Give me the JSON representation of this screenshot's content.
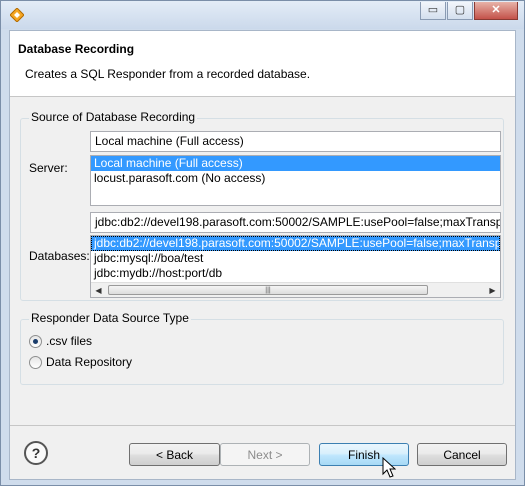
{
  "window": {
    "controls": {
      "minimize": "▭",
      "maximize": "▢",
      "close": "✕"
    }
  },
  "header": {
    "title": "Database Recording",
    "description": "Creates a SQL Responder from a recorded database."
  },
  "source_group": {
    "label": "Source of Database Recording",
    "server": {
      "label": "Server:",
      "value": "Local machine (Full access)",
      "options": [
        "Local machine (Full access)",
        "locust.parasoft.com (No access)"
      ],
      "selected_index": 0
    },
    "databases": {
      "label": "Databases:",
      "value": "jdbc:db2://devel198.parasoft.com:50002/SAMPLE:usePool=false;maxTranspo",
      "options": [
        "jdbc:db2://devel198.parasoft.com:50002/SAMPLE:usePool=false;maxTranspo",
        "jdbc:mysql://boa/test",
        "jdbc:mydb://host:port/db"
      ],
      "selected_index": 0
    }
  },
  "type_group": {
    "label": "Responder Data Source Type",
    "options": [
      {
        "label": ".csv files",
        "checked": true
      },
      {
        "label": "Data Repository",
        "checked": false
      }
    ]
  },
  "buttons": {
    "help": "?",
    "back": "< Back",
    "next": "Next >",
    "finish": "Finish",
    "cancel": "Cancel"
  },
  "colors": {
    "selection": "#3399ff",
    "frame": "#cfdcec"
  },
  "icons": [
    "app-icon",
    "minimize-icon",
    "maximize-icon",
    "close-icon",
    "help-icon",
    "scroll-left-icon",
    "scroll-right-icon",
    "mouse-cursor-icon"
  ]
}
